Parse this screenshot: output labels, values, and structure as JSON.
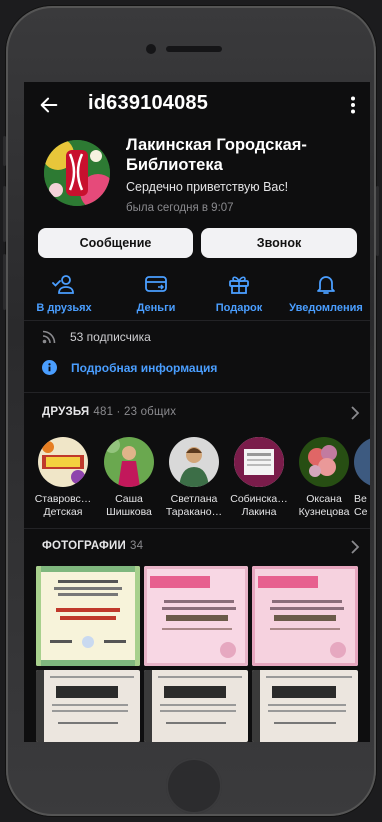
{
  "header": {
    "page_id": "id639104085"
  },
  "profile": {
    "name": "Лакинская Городская-Библиотека",
    "status": "Сердечно приветствую Вас!",
    "last_seen": "была сегодня в 9:07"
  },
  "buttons": {
    "message": "Сообщение",
    "call": "Звонок"
  },
  "actions": [
    {
      "label": "В друзьях",
      "icon": "friend-check-icon"
    },
    {
      "label": "Деньги",
      "icon": "money-transfer-icon"
    },
    {
      "label": "Подарок",
      "icon": "gift-icon"
    },
    {
      "label": "Уведомления",
      "icon": "bell-icon"
    }
  ],
  "subscribers": "53 подписчика",
  "details": "Подробная информация",
  "friends": {
    "title": "ДРУЗЬЯ",
    "count": "481 · 23 общих",
    "items": [
      {
        "line1": "Ставровс…",
        "line2": "Детская"
      },
      {
        "line1": "Саша",
        "line2": "Шишкова"
      },
      {
        "line1": "Светлана",
        "line2": "Тараканo…"
      },
      {
        "line1": "Собинска…",
        "line2": "Лакина"
      },
      {
        "line1": "Оксана",
        "line2": "Кузнецова"
      },
      {
        "line1": "Ве",
        "line2": "Се"
      }
    ]
  },
  "photos": {
    "title": "ФОТОГРАФИИ",
    "count": "34"
  },
  "colors": {
    "accent": "#4a9eff",
    "background": "#0e0e0f",
    "button_bg": "#f2f2f4"
  }
}
